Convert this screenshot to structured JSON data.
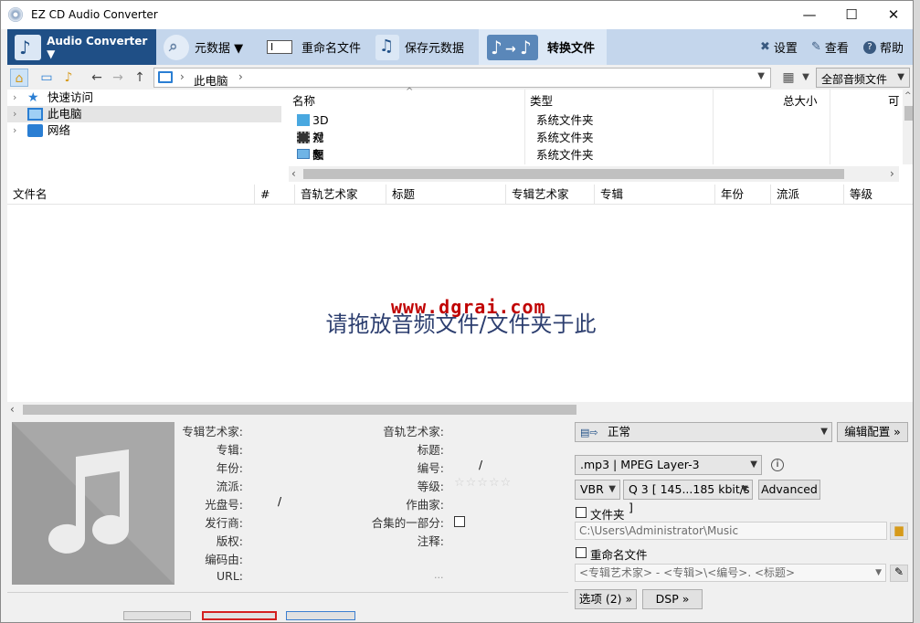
{
  "window": {
    "title": "EZ CD Audio Converter",
    "minimize": "—",
    "maximize": "☐",
    "close": "✕"
  },
  "toolbar": {
    "audio_converter": "Audio Converter ▼",
    "metadata": "元数据 ▼",
    "rename": "重命名文件",
    "save_metadata": "保存元数据",
    "convert": "转换文件",
    "settings": "设置",
    "view": "查看",
    "help": "帮助"
  },
  "nav": {
    "path": "此电脑",
    "sep1": "›",
    "sep2": "›",
    "filter": "全部音频文件"
  },
  "tree": [
    {
      "label": "快速访问"
    },
    {
      "label": "此电脑"
    },
    {
      "label": "网络"
    }
  ],
  "files": {
    "columns": [
      "名称",
      "类型",
      "总大小",
      "可"
    ],
    "rows": [
      {
        "name": "3D 对象",
        "type": "系统文件夹"
      },
      {
        "name": "视频",
        "type": "系统文件夹"
      },
      {
        "name": "图片",
        "type": "系统文件夹"
      }
    ]
  },
  "tracks": {
    "columns": [
      "文件名",
      "#",
      "音轨艺术家",
      "标题",
      "专辑艺术家",
      "专辑",
      "年份",
      "流派",
      "等级"
    ],
    "drop_hint": "请拖放音频文件/文件夹于此",
    "watermark": "www.dgrai.com"
  },
  "metadata": {
    "left_labels": [
      "专辑艺术家:",
      "专辑:",
      "年份:",
      "流派:",
      "光盘号:",
      "发行商:",
      "版权:",
      "编码由:",
      "URL:"
    ],
    "right_labels": [
      "音轨艺术家:",
      "标题:",
      "编号:",
      "等级:",
      "作曲家:",
      "合集的一部分:",
      "注释:"
    ],
    "disc_sep": "/",
    "track_sep": "/",
    "stars": "☆☆☆☆☆",
    "url_dots": "..."
  },
  "output": {
    "profile": "正常",
    "edit_profile": "编辑配置 »",
    "format": ".mp3 | MPEG Layer-3",
    "mode": "VBR",
    "quality": "Q 3  [ 145...185 kbit/s ]",
    "advanced": "Advanced",
    "folder_label": "文件夹",
    "folder_path": "C:\\Users\\Administrator\\Music",
    "rename_label": "重命名文件",
    "rename_pattern": "<专辑艺术家> - <专辑>\\<编号>. <标题>",
    "options": "选项 (2) »",
    "dsp": "DSP »"
  },
  "colors": {
    "accent": "#1f4f86",
    "toolbar": "#c4d6ec",
    "watermark": "#c00000",
    "hint": "#2c3e6f"
  }
}
